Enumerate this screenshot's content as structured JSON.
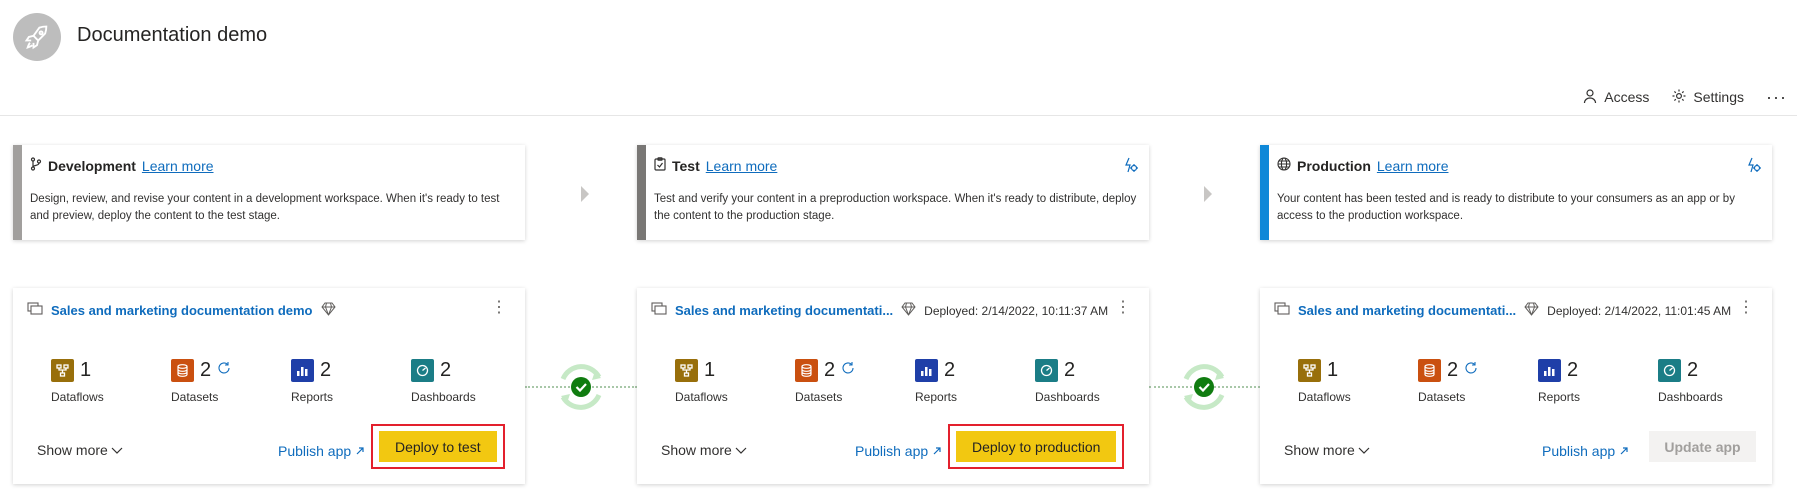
{
  "workspace": {
    "title": "Documentation demo",
    "icon": "rocket-icon"
  },
  "toolbar": {
    "access_label": "Access",
    "settings_label": "Settings",
    "more_label": "···"
  },
  "stages": [
    {
      "name": "Development",
      "learn_more": "Learn more",
      "description": "Design, review, and revise your content in a development workspace. When it's ready to test and preview, deploy the content to the test stage.",
      "accent": "#a19f9d",
      "icon": "branch-icon"
    },
    {
      "name": "Test",
      "learn_more": "Learn more",
      "description": "Test and verify your content in a preproduction workspace. When it's ready to distribute, deploy the content to the production stage.",
      "accent": "#797775",
      "icon": "clipboard-icon"
    },
    {
      "name": "Production",
      "learn_more": "Learn more",
      "description": "Your content has been tested and is ready to distribute to your consumers as an app or by access to the production workspace.",
      "accent": "#0f88d8",
      "icon": "globe-icon"
    }
  ],
  "cards": [
    {
      "workspace_name": "Sales and marketing documentation demo",
      "deployed": "",
      "items": [
        {
          "count": "1",
          "label": "Dataflows",
          "color": "#986f0b"
        },
        {
          "count": "2",
          "label": "Datasets",
          "color": "#ca5010"
        },
        {
          "count": "2",
          "label": "Reports",
          "color": "#1f3fa8"
        },
        {
          "count": "2",
          "label": "Dashboards",
          "color": "#1b7d86"
        }
      ],
      "show_more": "Show more",
      "publish": "Publish app",
      "action": "Deploy to test"
    },
    {
      "workspace_name": "Sales and marketing documentati...",
      "deployed": "Deployed: 2/14/2022, 10:11:37 AM",
      "items": [
        {
          "count": "1",
          "label": "Dataflows",
          "color": "#986f0b"
        },
        {
          "count": "2",
          "label": "Datasets",
          "color": "#ca5010"
        },
        {
          "count": "2",
          "label": "Reports",
          "color": "#1f3fa8"
        },
        {
          "count": "2",
          "label": "Dashboards",
          "color": "#1b7d86"
        }
      ],
      "show_more": "Show more",
      "publish": "Publish app",
      "action": "Deploy to production"
    },
    {
      "workspace_name": "Sales and marketing documentati...",
      "deployed": "Deployed: 2/14/2022, 11:01:45 AM",
      "items": [
        {
          "count": "1",
          "label": "Dataflows",
          "color": "#986f0b"
        },
        {
          "count": "2",
          "label": "Datasets",
          "color": "#ca5010"
        },
        {
          "count": "2",
          "label": "Reports",
          "color": "#1f3fa8"
        },
        {
          "count": "2",
          "label": "Dashboards",
          "color": "#1b7d86"
        }
      ],
      "show_more": "Show more",
      "publish": "Publish app",
      "action": "Update app"
    }
  ],
  "sync_status": [
    "in-sync",
    "in-sync"
  ]
}
